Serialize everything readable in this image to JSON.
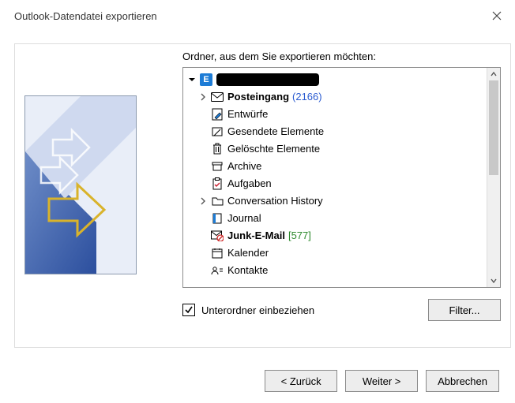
{
  "window": {
    "title": "Outlook-Datendatei exportieren"
  },
  "instruction": "Ordner, aus dem Sie exportieren möchten:",
  "tree": {
    "root": {
      "label": ""
    },
    "items": [
      {
        "label": "Posteingang",
        "count": "(2166)",
        "bold": true,
        "countColor": "blue",
        "icon": "inbox"
      },
      {
        "label": "Entwürfe",
        "icon": "drafts"
      },
      {
        "label": "Gesendete Elemente",
        "icon": "sent"
      },
      {
        "label": "Gelöschte Elemente",
        "icon": "trash"
      },
      {
        "label": "Archive",
        "icon": "archive"
      },
      {
        "label": "Aufgaben",
        "icon": "tasks"
      },
      {
        "label": "Conversation History",
        "icon": "folder"
      },
      {
        "label": "Journal",
        "icon": "journal"
      },
      {
        "label": "Junk-E-Mail",
        "count": "[577]",
        "bold": true,
        "countColor": "green",
        "icon": "junk"
      },
      {
        "label": "Kalender",
        "icon": "calendar"
      },
      {
        "label": "Kontakte",
        "icon": "contacts"
      }
    ]
  },
  "checkbox": {
    "label": "Unterordner einbeziehen",
    "checked": true
  },
  "buttons": {
    "filter": "Filter...",
    "back": "< Zurück",
    "next": "Weiter >",
    "cancel": "Abbrechen"
  }
}
